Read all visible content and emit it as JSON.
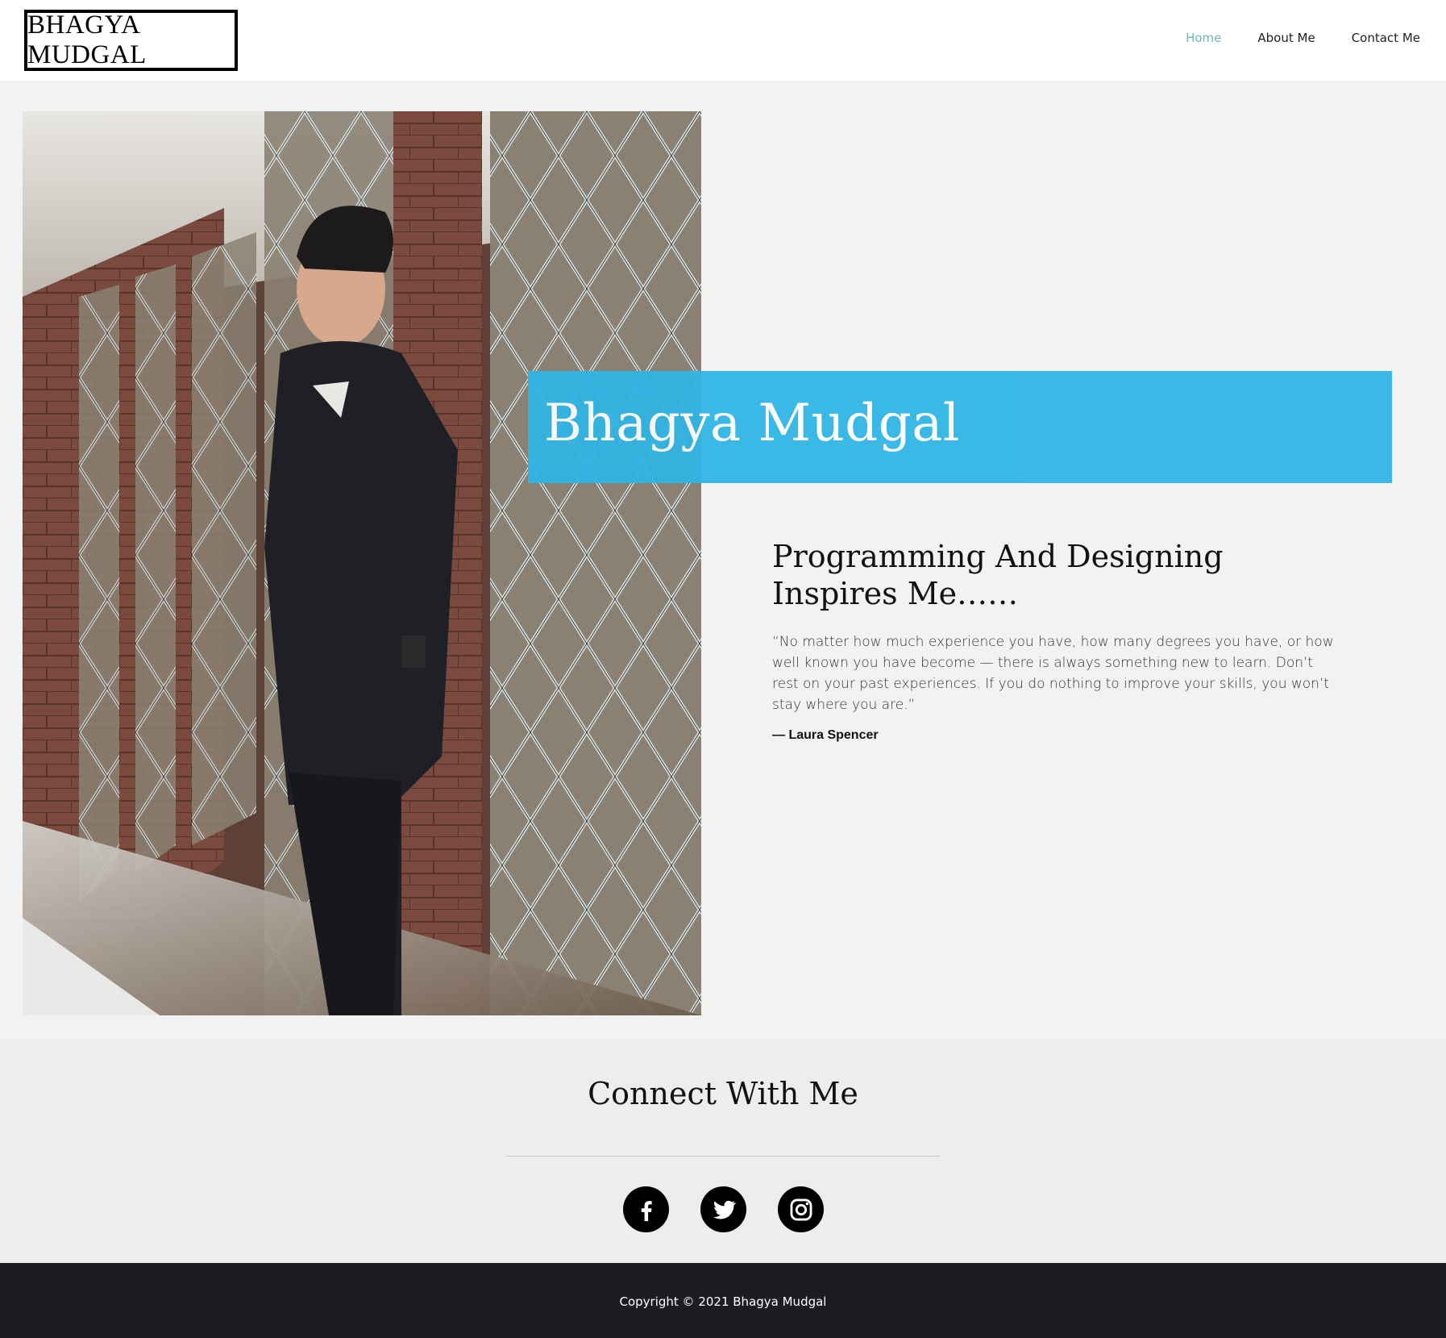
{
  "header": {
    "logo_text": "BHAGYA MUDGAL",
    "nav": [
      {
        "label": "Home",
        "active": true
      },
      {
        "label": "About Me",
        "active": false
      },
      {
        "label": "Contact Me",
        "active": false
      }
    ]
  },
  "hero": {
    "name": "Bhagya Mudgal",
    "tagline": "Programming And Designing Inspires Me……",
    "quote": "“No matter how much experience you have, how many degrees you have, or how well known you have become — there is always something new to learn. Don’t rest on your past experiences. If you do nothing to improve your skills, you won’t stay where you are.”",
    "author": "— Laura Spencer"
  },
  "connect": {
    "title": "Connect With Me",
    "socials": [
      {
        "icon": "facebook-icon"
      },
      {
        "icon": "twitter-icon"
      },
      {
        "icon": "instagram-icon"
      }
    ]
  },
  "footer": {
    "copyright": "Copyright © 2021 Bhagya Mudgal"
  },
  "colors": {
    "accent_banner": "#2eb5e6",
    "nav_active": "#6fb6c2",
    "footer_bg": "#1b1d20",
    "page_bg": "#f2f2f2"
  }
}
